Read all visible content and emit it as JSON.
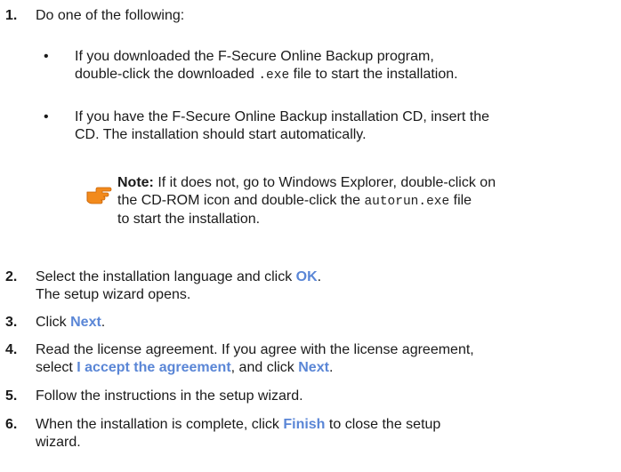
{
  "steps": [
    {
      "num": "1.",
      "text": "Do one of the following:"
    },
    {
      "num": "2.",
      "line1_pre": "Select the installation language and click ",
      "line1_ui": "OK",
      "line1_post": ".",
      "line2": "The setup wizard opens."
    },
    {
      "num": "3.",
      "pre": "Click ",
      "ui": "Next",
      "post": "."
    },
    {
      "num": "4.",
      "line1": "Read the license agreement. If you agree with the license agreement,",
      "line2_pre": "select ",
      "line2_ui1": "I accept the agreement",
      "line2_mid": ", and click ",
      "line2_ui2": "Next",
      "line2_post": "."
    },
    {
      "num": "5.",
      "text": "Follow the instructions in the setup wizard."
    },
    {
      "num": "6.",
      "line1_pre": "When the installation is complete, click ",
      "line1_ui": "Finish",
      "line1_post": " to close the setup",
      "line2": "wizard."
    }
  ],
  "bullets": [
    {
      "mark": "•",
      "line1": "If you downloaded the F-Secure Online Backup program,",
      "line2_pre": "double-click the downloaded ",
      "line2_code": ".exe",
      "line2_post": " file to start the installation."
    },
    {
      "mark": "•",
      "line1": "If you have the F-Secure Online Backup installation CD, insert the",
      "line2": "CD. The installation should start automatically."
    }
  ],
  "note": {
    "label": "Note:",
    "line1": " If it does not, go to Windows Explorer, double-click on",
    "line2_pre": "the CD-ROM icon and double-click the ",
    "line2_code": "autorun.exe",
    "line2_post": " file",
    "line3": "to start the installation.",
    "icon": "pointing-hand-icon"
  }
}
